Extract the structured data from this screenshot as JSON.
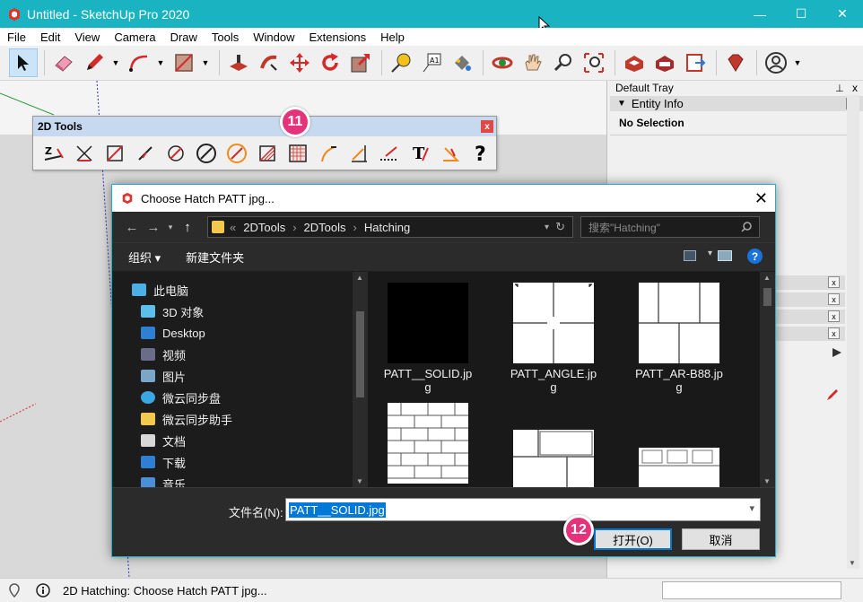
{
  "window": {
    "title": "Untitled - SketchUp Pro 2020",
    "minimize": "—",
    "maximize": "☐",
    "close": "✕",
    "accent": "#19b3c2"
  },
  "menu": [
    "File",
    "Edit",
    "View",
    "Camera",
    "Draw",
    "Tools",
    "Window",
    "Extensions",
    "Help"
  ],
  "toolbar": {
    "tools": [
      "select-icon",
      "eraser-icon",
      "pencil-icon",
      "arc-icon",
      "rectangle-icon",
      "push-pull-icon",
      "follow-me-icon",
      "move-icon",
      "rotate-icon",
      "scale-icon",
      "tape-measure-icon",
      "text-icon",
      "paint-bucket-icon",
      "orbit-icon",
      "pan-icon",
      "zoom-icon",
      "zoom-extents-icon",
      "warehouse-icon",
      "extension-warehouse-icon",
      "layout-icon",
      "ruby-icon",
      "account-icon"
    ]
  },
  "tools2d": {
    "title": "2D Tools",
    "close": "x",
    "badge": "11",
    "icons": [
      "2d-text-icon",
      "2d-erase-icon",
      "2d-rectangle-icon",
      "2d-line-icon",
      "2d-arc-icon",
      "2d-circle-icon",
      "2d-offset-icon",
      "2d-trim-icon",
      "2d-hatch-icon",
      "2d-extend-icon",
      "2d-dimension-icon",
      "2d-leader-icon",
      "2d-text-tool-icon",
      "2d-angle-icon",
      "help-icon"
    ]
  },
  "tray": {
    "title": "Default Tray",
    "pin": "⊥",
    "close": "x",
    "panel": "Entity Info",
    "no_selection": "No Selection"
  },
  "dialog": {
    "title": "Choose Hatch PATT jpg...",
    "close": "✕",
    "breadcrumb_prefix": "«",
    "breadcrumb": [
      "2DTools",
      "2DTools",
      "Hatching"
    ],
    "search_placeholder": "搜索\"Hatching\"",
    "organize": "组织 ▾",
    "new_folder": "新建文件夹",
    "nav": [
      "此电脑",
      "3D 对象",
      "Desktop",
      "视频",
      "图片",
      "微云同步盘",
      "微云同步助手",
      "文档",
      "下载",
      "音乐"
    ],
    "files": [
      {
        "name": "PATT__SOLID.jpg",
        "line1": "PATT__SOLID.jp",
        "line2": "g"
      },
      {
        "name": "PATT_ANGLE.jpg",
        "line1": "PATT_ANGLE.jp",
        "line2": "g"
      },
      {
        "name": "PATT_AR-B88.jpg",
        "line1": "PATT_AR-B88.jp",
        "line2": "g"
      }
    ],
    "filename_label": "文件名(N):",
    "filename_value": "PATT__SOLID.jpg",
    "open_button": "打开(O)",
    "cancel_button": "取消",
    "badge": "12"
  },
  "status": {
    "text": "2D Hatching: Choose Hatch PATT jpg..."
  }
}
